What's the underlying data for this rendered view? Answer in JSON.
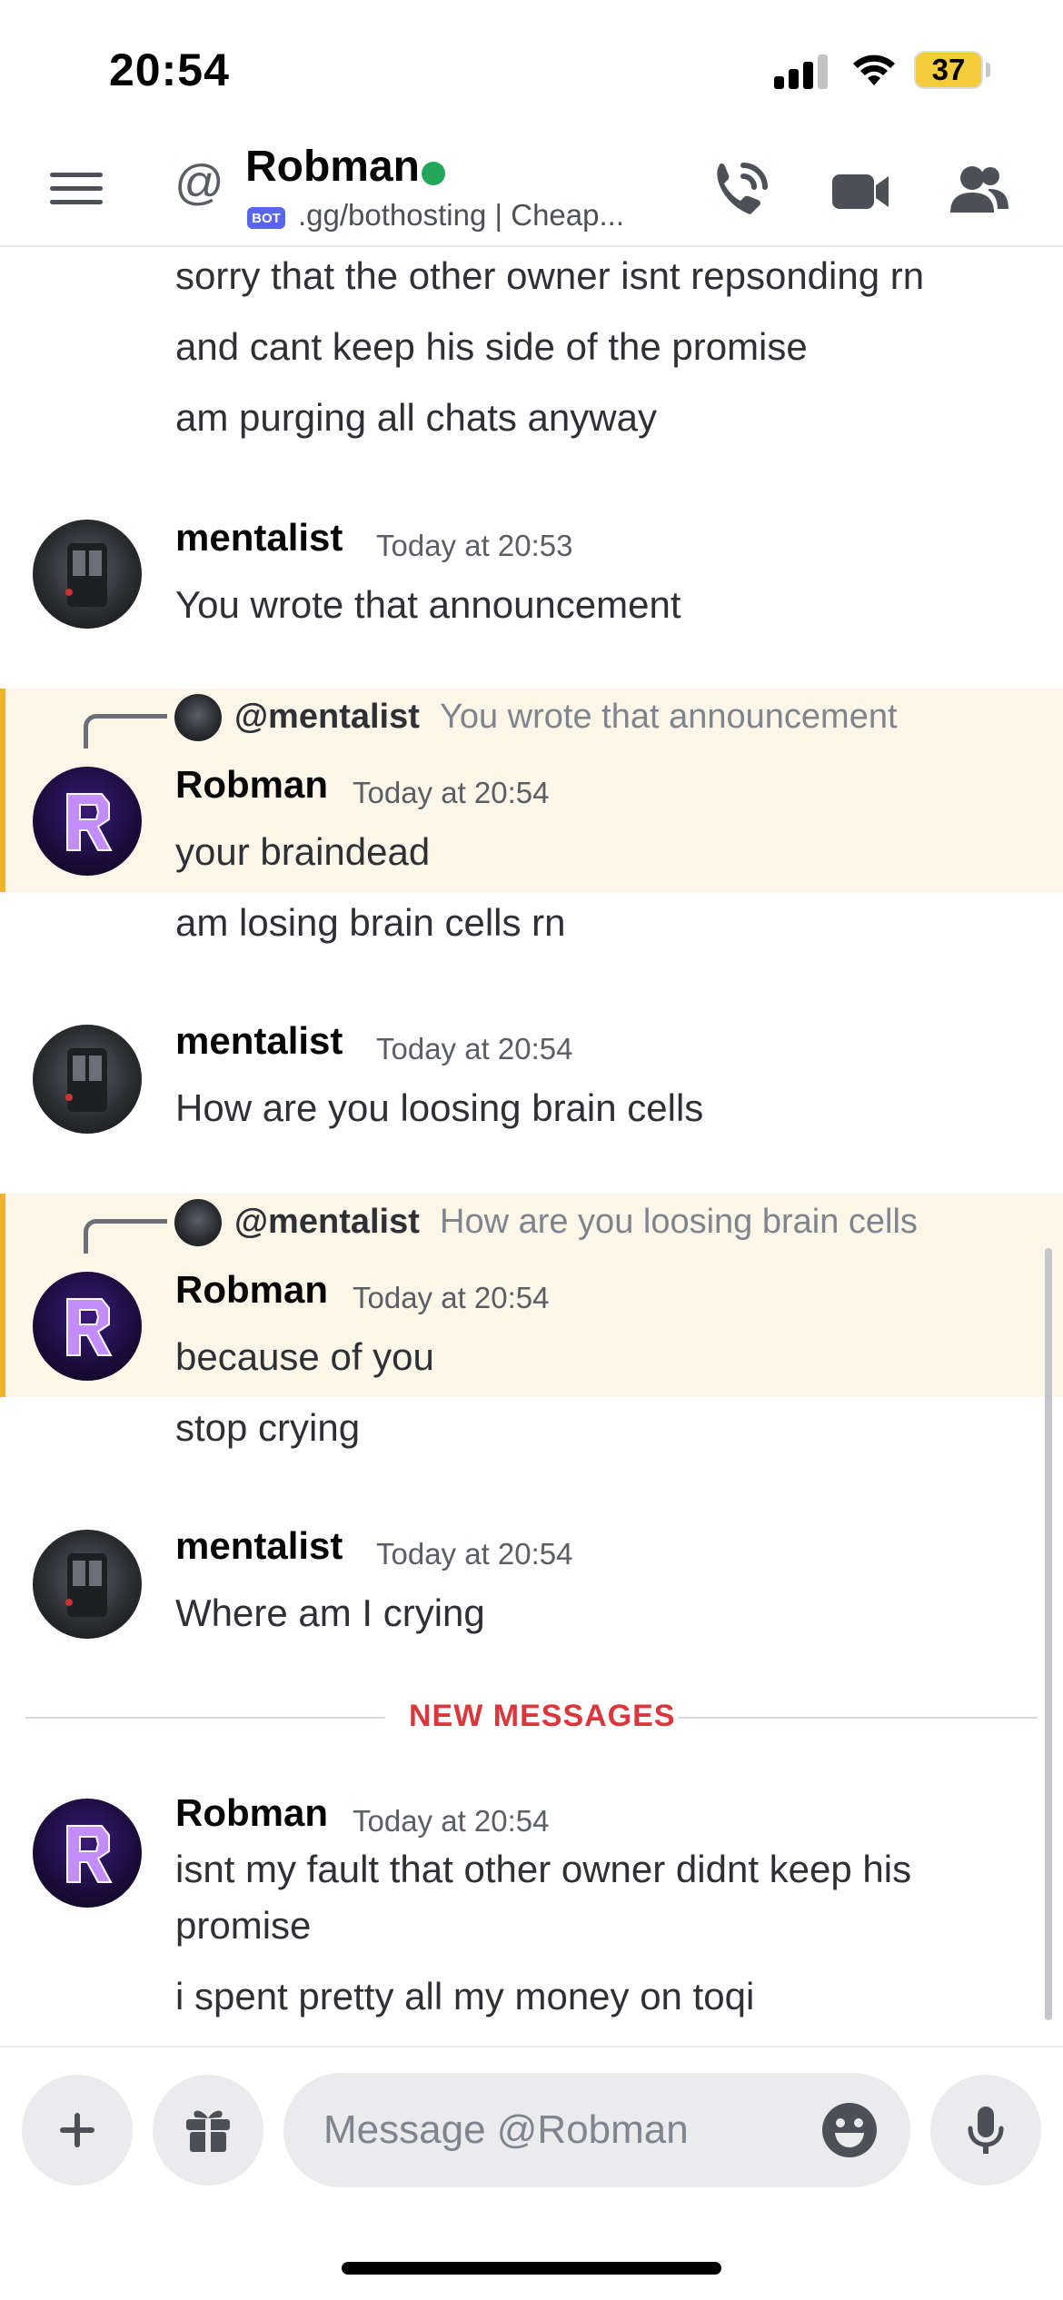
{
  "status_bar": {
    "time": "20:54",
    "battery": "37"
  },
  "header": {
    "title": "Robman",
    "bot_badge": "BOT",
    "subtitle": ".gg/bothosting | Cheap..."
  },
  "messages": {
    "cont_lines": [
      "sorry that the other owner isnt repsonding rn",
      "and cant keep his side of the promise",
      "am purging all chats anyway"
    ],
    "m1": {
      "user": "mentalist",
      "time": "Today at 20:53",
      "text": "You wrote that announcement"
    },
    "r1": {
      "reply_user": "@mentalist",
      "reply_text": "You wrote that announcement",
      "user": "Robman",
      "time": "Today at 20:54",
      "lines": [
        "your braindead",
        "am losing brain cells rn"
      ]
    },
    "m2": {
      "user": "mentalist",
      "time": "Today at 20:54",
      "text": "How are you loosing brain cells"
    },
    "r2": {
      "reply_user": "@mentalist",
      "reply_text": "How are you loosing brain cells",
      "user": "Robman",
      "time": "Today at 20:54",
      "lines": [
        "because of you",
        "stop crying"
      ]
    },
    "m3": {
      "user": "mentalist",
      "time": "Today at 20:54",
      "text": "Where am I crying"
    },
    "divider": "NEW MESSAGES",
    "r3": {
      "user": "Robman",
      "time": "Today at 20:54",
      "lines": [
        "isnt my fault that other owner didnt keep his",
        "promise",
        "i spent pretty all my money on toqi"
      ]
    }
  },
  "composer": {
    "placeholder": "Message @Robman"
  },
  "colors": {
    "accent": "#5865f2",
    "online": "#23a55a",
    "new_messages": "#da373c",
    "mention_highlight": "#fbf6e8",
    "mention_bar": "#f0b232"
  },
  "icons": [
    "menu-icon",
    "at-icon",
    "call-icon",
    "video-icon",
    "members-icon",
    "plus-icon",
    "gift-icon",
    "emoji-icon",
    "mic-icon"
  ]
}
